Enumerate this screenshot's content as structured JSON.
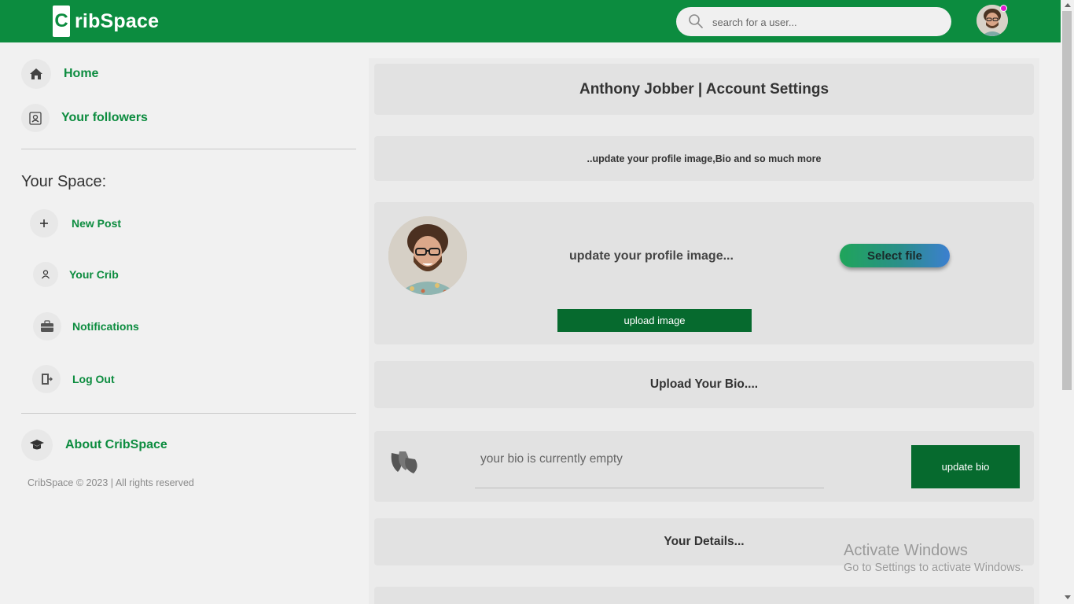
{
  "header": {
    "logo_letter": "C",
    "logo_text": "ribSpace",
    "search_placeholder": "search for a user...",
    "accent": "#0c8c3f"
  },
  "sidebar": {
    "nav": [
      {
        "label": "Home",
        "icon": "home-icon"
      },
      {
        "label": "Your followers",
        "icon": "contact-card-icon"
      }
    ],
    "space_title": "Your Space:",
    "space_items": [
      {
        "label": "New Post",
        "icon": "plus-icon"
      },
      {
        "label": "Your Crib",
        "icon": "person-icon"
      },
      {
        "label": "Notifications",
        "icon": "briefcase-icon"
      },
      {
        "label": "Log Out",
        "icon": "logout-door-icon"
      }
    ],
    "about": {
      "label": "About CribSpace",
      "icon": "graduation-cap-icon"
    },
    "footer": "CribSpace © 2023 | All rights reserved"
  },
  "main": {
    "title": "Anthony Jobber | Account Settings",
    "subtitle": "..update your profile image,Bio and so much more",
    "profile_image_label": "update your profile image...",
    "select_file": "Select file",
    "upload_image": "upload image",
    "bio_heading": "Upload Your Bio....",
    "bio_text": "your bio is currently empty",
    "update_bio": "update bio",
    "details_heading": "Your Details..."
  },
  "watermark": {
    "line1": "Activate Windows",
    "line2": "Go to Settings to activate Windows."
  }
}
